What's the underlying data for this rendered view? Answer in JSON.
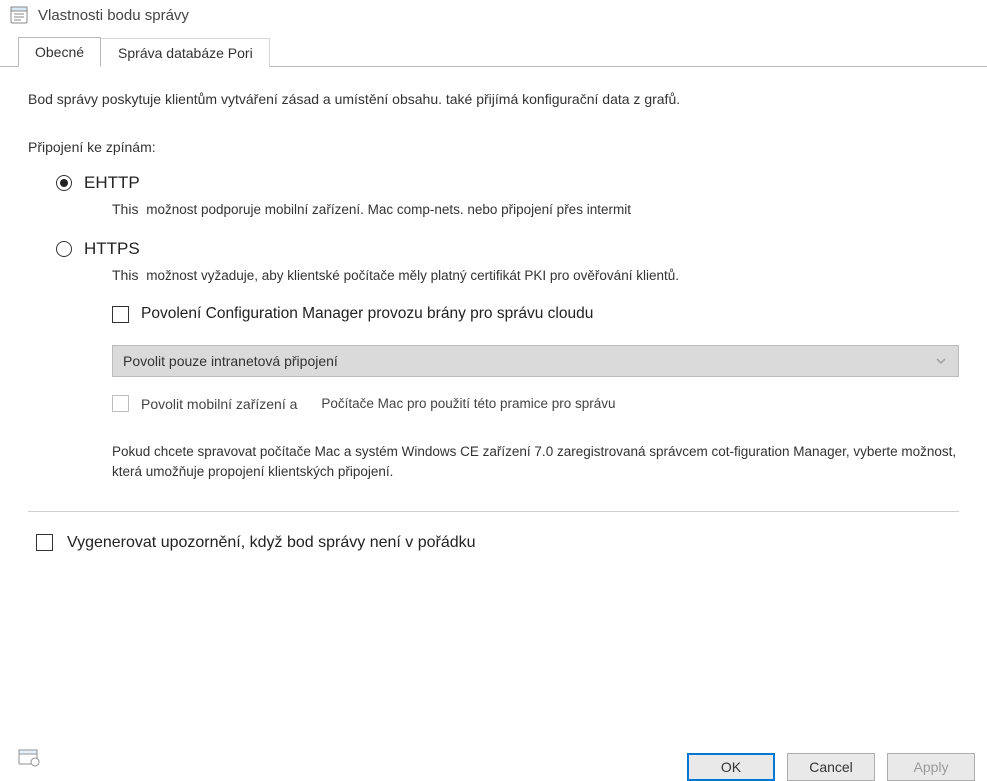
{
  "window": {
    "title": "Vlastnosti bodu správy"
  },
  "tabs": {
    "general": "Obecné",
    "db": "Správa databáze Pori"
  },
  "panel": {
    "description": "Bod správy poskytuje klientům vytváření zásad a umístění obsahu. také přijímá konfigurační data z grafů.",
    "connectionsLabel": "Připojení ke zpínám:",
    "ehttp": {
      "label": "EHTTP",
      "descLead": "This",
      "desc": "možnost podporuje mobilní zařízení. Mac comp-nets. nebo připojení přes intermit"
    },
    "https": {
      "label": "HTTPS",
      "descLead": "This",
      "desc": "možnost vyžaduje, aby klientské počítače měly platný certifikát PKI pro ověřování klientů."
    },
    "allowCmg": "Povolení Configuration Manager provozu brány pro správu cloudu",
    "dropdown": "Povolit pouze intranetová připojení",
    "allowMobile": {
      "primary": "Povolit mobilní zařízení a",
      "secondary": "Počítače Mac pro použití této pramice pro správu"
    },
    "macNote": "Pokud chcete spravovat počítače Mac a systém Windows CE zařízení 7.0 zaregistrovaná správcem cot-figuration Manager, vyberte možnost, která umožňuje propojení klientských připojení.",
    "generateAlert": "Vygenerovat upozornění, když bod správy není v pořádku"
  },
  "buttons": {
    "ok": "OK",
    "cancel": "Cancel",
    "apply": "Apply"
  }
}
